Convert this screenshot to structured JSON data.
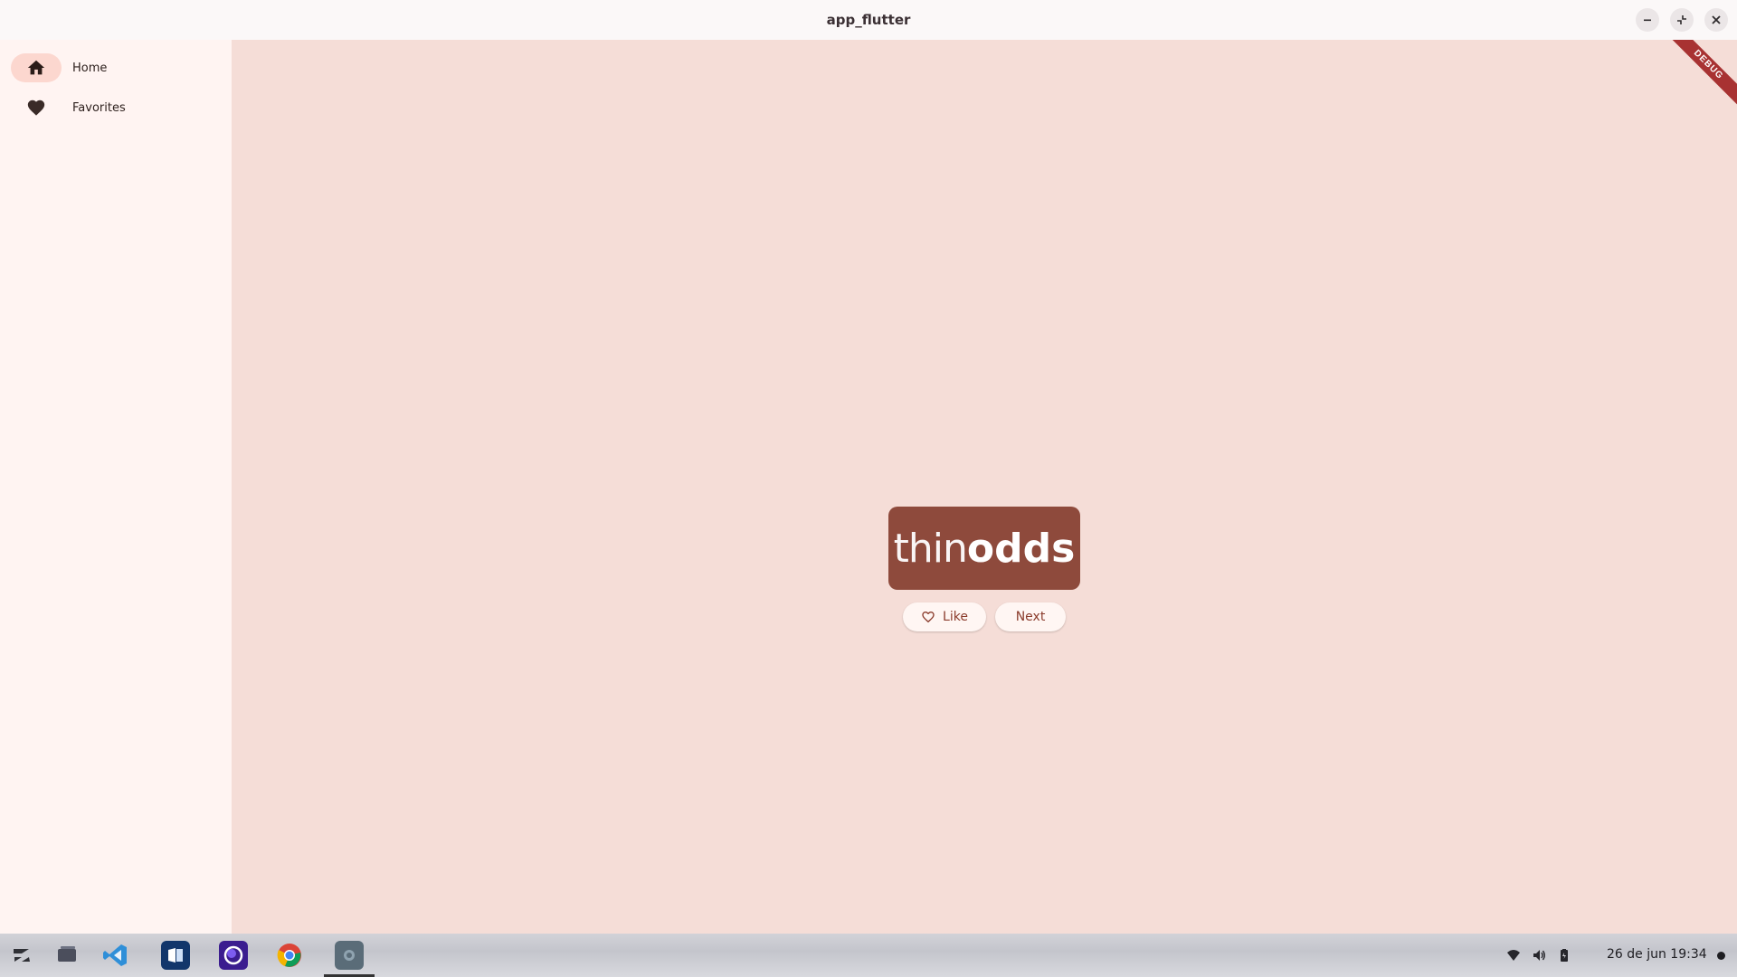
{
  "window": {
    "title": "app_flutter"
  },
  "nav": {
    "items": [
      {
        "label": "Home",
        "icon": "home-icon",
        "active": true
      },
      {
        "label": "Favorites",
        "icon": "heart-icon",
        "active": false
      }
    ]
  },
  "main": {
    "debug_label": "DEBUG",
    "word": {
      "first": "thin",
      "second": "odds"
    },
    "like_label": "Like",
    "next_label": "Next"
  },
  "taskbar": {
    "apps": [
      "zorin-menu-icon",
      "files-icon",
      "vscode-icon",
      "word-app-icon",
      "app-purple-icon",
      "chrome-icon",
      "flutter-app-icon"
    ],
    "clock": "26 de jun  19:34"
  },
  "colors": {
    "accent": "#8e4a3c",
    "background": "#f5ddd7",
    "rail": "#fff4f2"
  }
}
